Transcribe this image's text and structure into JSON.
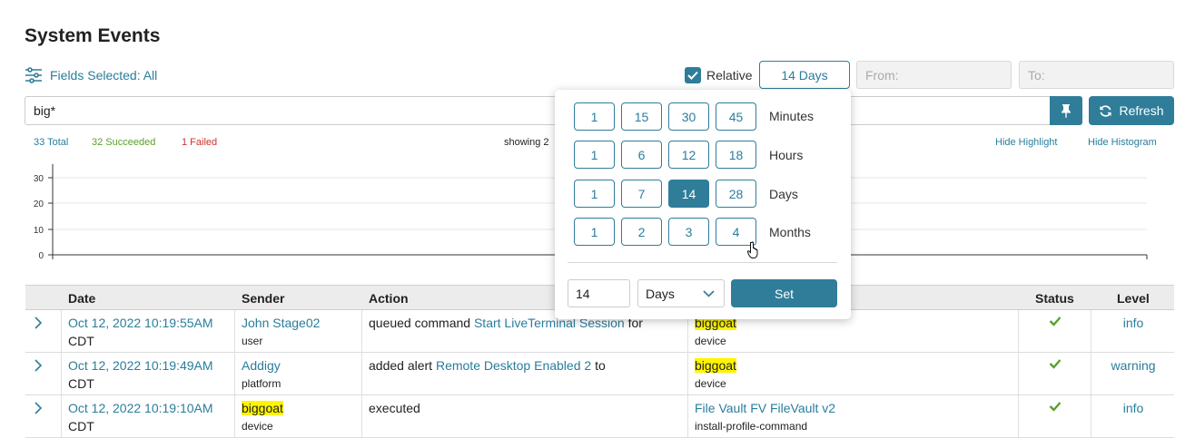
{
  "page": {
    "title": "System Events"
  },
  "toolbar": {
    "fields_selected": "Fields Selected: All",
    "relative_label": "Relative",
    "relative_checked": true,
    "range_value": "14 Days",
    "from_placeholder": "From:",
    "to_placeholder": "To:",
    "search_value": "big*",
    "refresh_label": "Refresh"
  },
  "stats": {
    "total": "33 Total",
    "succeeded": "32 Succeeded",
    "failed": "1 Failed",
    "showing": "showing 2",
    "hide_highlight": "Hide Highlight",
    "hide_histogram": "Hide Histogram"
  },
  "histogram": {
    "y_ticks": [
      "30",
      "20",
      "10",
      "0"
    ]
  },
  "chart_data": {
    "type": "bar",
    "categories": [],
    "values": [],
    "title": "",
    "xlabel": "",
    "ylabel": "",
    "ylim": [
      0,
      30
    ],
    "grid": true
  },
  "table": {
    "columns": [
      "Date",
      "Sender",
      "Action",
      "Status",
      "Level"
    ],
    "rows": [
      {
        "date": "Oct 12, 2022 10:19:55AM",
        "tz": "CDT",
        "sender": "John Stage02",
        "sender_type": "user",
        "action_prefix": "queued command",
        "action_link": "Start LiveTerminal Session",
        "action_suffix": "for",
        "target": "biggoat",
        "target_type": "device",
        "status": "success",
        "level": "info"
      },
      {
        "date": "Oct 12, 2022 10:19:49AM",
        "tz": "CDT",
        "sender": "Addigy",
        "sender_type": "platform",
        "action_prefix": "added alert",
        "action_link": "Remote Desktop Enabled 2",
        "action_suffix": "to",
        "target": "biggoat",
        "target_type": "device",
        "status": "success",
        "level": "warning"
      },
      {
        "date": "Oct 12, 2022 10:19:10AM",
        "tz": "CDT",
        "sender": "biggoat",
        "sender_type": "device",
        "action_prefix": "executed",
        "action_link": "",
        "action_suffix": "",
        "target": "File Vault FV FileVault v2",
        "target_type": "install-profile-command",
        "status": "success",
        "level": "info"
      }
    ]
  },
  "range_popup": {
    "rows": [
      {
        "unit": "Minutes",
        "options": [
          "1",
          "15",
          "30",
          "45"
        ]
      },
      {
        "unit": "Hours",
        "options": [
          "1",
          "6",
          "12",
          "18"
        ]
      },
      {
        "unit": "Days",
        "options": [
          "1",
          "7",
          "14",
          "28"
        ]
      },
      {
        "unit": "Months",
        "options": [
          "1",
          "2",
          "3",
          "4"
        ]
      }
    ],
    "selected": {
      "unit": "Days",
      "value": "14"
    },
    "custom_value": "14",
    "custom_unit": "Days",
    "set_label": "Set"
  },
  "colors": {
    "accent": "#2f7d99",
    "link": "#2a7d9c",
    "success": "#5aa02c",
    "failed": "#d0312d",
    "highlight": "#fff500"
  }
}
